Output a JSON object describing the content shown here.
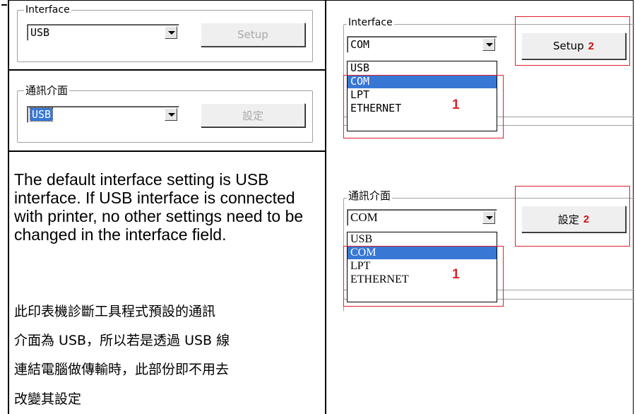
{
  "left_panel": {
    "english_group": {
      "title": "Interface",
      "combo_value": "USB",
      "button_label": "Setup"
    },
    "chinese_group": {
      "title": "通訊介面",
      "combo_value": "USB",
      "button_label": "設定"
    },
    "description_en": "The default interface setting is USB interface. If USB interface is connected with printer, no other settings need to be changed in the interface field.",
    "description_zh_lines": [
      "此印表機診斷工具程式預設的通訊",
      "介面為 USB，所以若是透過 USB 線",
      "連結電腦做傳輸時，此部份即不用去",
      "改變其設定"
    ]
  },
  "right_panel": {
    "english_group": {
      "title": "Interface",
      "combo_value": "COM",
      "button_label": "Setup",
      "button_marker": "2",
      "dropdown_options": [
        "USB",
        "COM",
        "LPT",
        "ETHERNET"
      ],
      "selected_option": "COM",
      "list_marker": "1"
    },
    "chinese_group": {
      "title": "通訊介面",
      "combo_value": "COM",
      "button_label": "設定",
      "button_marker": "2",
      "dropdown_options": [
        "USB",
        "COM",
        "LPT",
        "ETHERNET"
      ],
      "selected_option": "COM",
      "list_marker": "1"
    }
  },
  "colors": {
    "highlight": "#3877d4",
    "annotation_red": "#e0202a",
    "disabled_text": "#a8a8a8"
  },
  "icons": [
    "dropdown-arrow-icon"
  ]
}
